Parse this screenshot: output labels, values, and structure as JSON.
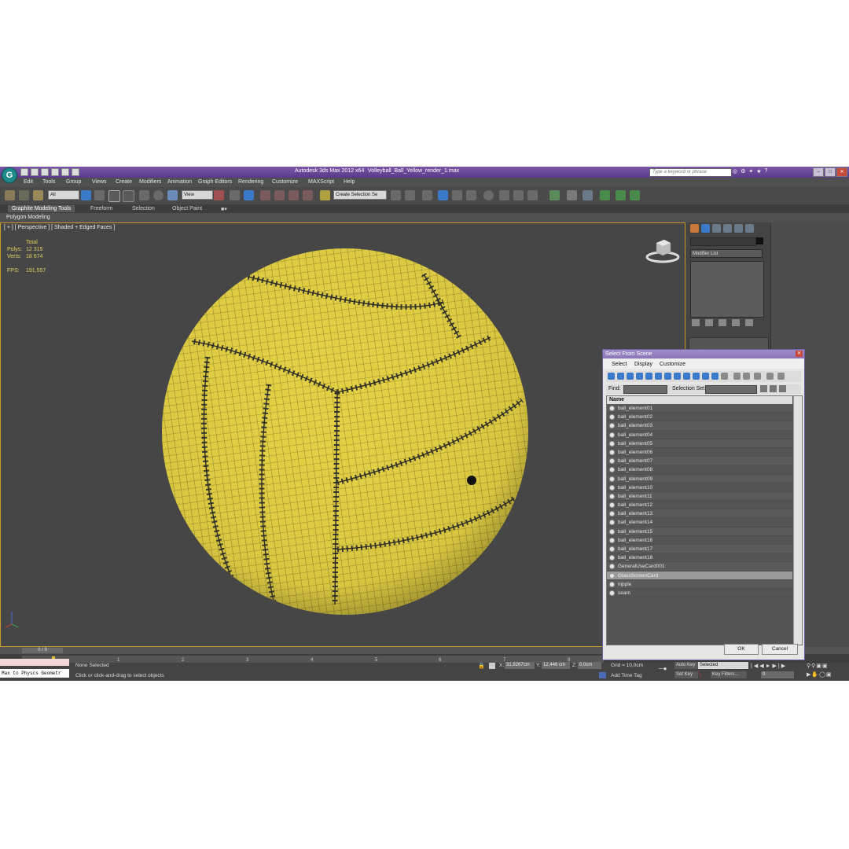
{
  "window": {
    "app_title": "Autodesk 3ds Max  2012 x64",
    "file_name": "Volleyball_Ball_Yellow_render_1.max",
    "search_placeholder": "Type a keyword or phrase",
    "logo_letter": "G"
  },
  "menu": [
    "Edit",
    "Tools",
    "Group",
    "Views",
    "Create",
    "Modifiers",
    "Animation",
    "Graph Editors",
    "Rendering",
    "Customize",
    "MAXScript",
    "Help"
  ],
  "toolbar": {
    "selection_filter": "All",
    "reference_coord": "View",
    "named_selection": "Create Selection Se"
  },
  "ribbon": {
    "tabs": [
      "Graphite Modeling Tools",
      "Freeform",
      "Selection",
      "Object Paint"
    ],
    "active_tab": "Graphite Modeling Tools",
    "sub_label": "Polygon Modeling"
  },
  "viewport": {
    "label": "[ + ] [ Perspective ] [ Shaded + Edged Faces ]",
    "stats": {
      "total_label": "Total",
      "polys_label": "Polys:",
      "polys": "12 315",
      "verts_label": "Verts:",
      "verts": "18 674",
      "fps_label": "FPS:",
      "fps": "191,557"
    },
    "colors": {
      "ball": "#e3d044",
      "seam": "#3a3a30",
      "wire": "#5a5218",
      "background": "#464646"
    }
  },
  "command_panel": {
    "modifier_list": "Modifier List"
  },
  "select_dialog": {
    "title": "Select From Scene",
    "menu": [
      "Select",
      "Display",
      "Customize"
    ],
    "find_label": "Find:",
    "selection_set_label": "Selection Set:",
    "column_name": "Name",
    "items": [
      "ball_element01",
      "ball_element02",
      "ball_element03",
      "ball_element04",
      "ball_element05",
      "ball_element06",
      "ball_element07",
      "ball_element08",
      "ball_element09",
      "ball_element10",
      "ball_element11",
      "ball_element12",
      "ball_element13",
      "ball_element14",
      "ball_element15",
      "ball_element16",
      "ball_element17",
      "ball_element18",
      "GeneralUseCard001",
      "GlassScreenCard",
      "nipple",
      "seam"
    ],
    "selected_item": "GlassScreenCard",
    "ok": "OK",
    "cancel": "Cancel"
  },
  "timeline": {
    "frame_counter": "0 / 9",
    "ticks": [
      "1",
      "2",
      "3",
      "4",
      "5",
      "6",
      "7",
      "8"
    ]
  },
  "status": {
    "maxscript_output": "Max to Physcs Geometr",
    "selection": "None Selected",
    "prompt": "Click or click-and-drag to select objects",
    "x_label": "X:",
    "x": "31,9267cm",
    "y_label": "Y:",
    "y": "12,446 cm",
    "z_label": "Z:",
    "z": "0,0cm",
    "grid": "Grid = 10,0cm",
    "add_time_tag": "Add Time Tag",
    "auto_key": "Auto Key",
    "set_key": "Set Key",
    "key_mode": "Selected",
    "key_filters": "Key Filters...",
    "current_frame": "0"
  }
}
